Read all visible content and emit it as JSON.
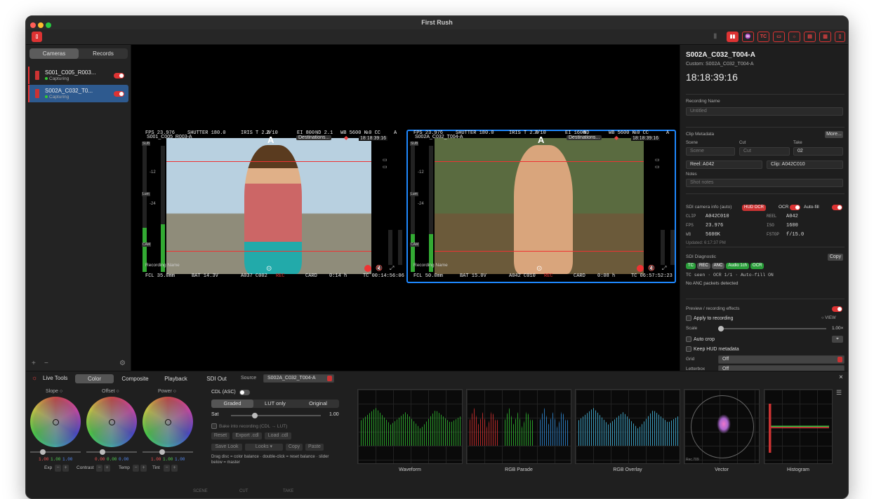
{
  "window": {
    "title": "First Rush"
  },
  "sidebar": {
    "tabs": [
      "Cameras",
      "Records"
    ],
    "cameras": [
      {
        "name": "S001_C005_R003...",
        "status": "Capturing"
      },
      {
        "name": "S002A_C032_T0...",
        "status": "Capturing"
      }
    ],
    "footer": {
      "add": "+",
      "remove": "−"
    }
  },
  "feeds": [
    {
      "name": "S001_C005_R003-A",
      "letter": "A",
      "destinations": "Destinations...",
      "tc": "18:18:39:16",
      "top": {
        "fps": "FPS 23.976",
        "shutter": "SHUTTER 180.0",
        "iris": "IRIS T 2.8",
        "iris_frac": "2/10",
        "ei": "EI 800",
        "nd": "ND 2.1",
        "wb": "WB 5600 K",
        "cc": "±0 CC",
        "a": "A"
      },
      "rec_label": "Recording Name",
      "bottom": {
        "fcl": "FCL 35.0mm",
        "bat": "BAT 14.3V",
        "clip": "A037 C002",
        "rec": "REC",
        "card": "CARD",
        "time": "0:14 h",
        "tcv": "TC 00:14:56:06"
      },
      "meter": {
        "marks": [
          "-12",
          "-24"
        ],
        "labels": [
          "SUB",
          "Lum",
          "CAM"
        ]
      },
      "levels": [
        0.35,
        0.38
      ],
      "colors": {
        "sky": "#b8d0e0",
        "ground": "#8f8c7a"
      }
    },
    {
      "name": "S002A_C032_T004-A",
      "letter": "A",
      "destinations": "Destinations...",
      "tc": "18:18:39:16",
      "top": {
        "fps": "FPS 23.976",
        "shutter": "SHUTTER 180.0",
        "iris": "IRIS T 2.8",
        "iris_frac": "7/10",
        "ei": "EI 1600",
        "nd": "ND",
        "wb": "WB 5600 K",
        "cc": "±0 CC",
        "a": "A"
      },
      "rec_label": "Recording Name",
      "bottom": {
        "fcl": "FCL 50.0mm",
        "bat": "BAT 15.0V",
        "clip": "A042 C010",
        "rec": "REC",
        "card": "CARD",
        "time": "0:08 h",
        "tcv": "TC 06:57:52:23"
      },
      "meter": {
        "marks": [
          "-12",
          "-24"
        ],
        "labels": [
          "SUB",
          "Lum",
          "CAM"
        ]
      },
      "levels": [
        0.3,
        0.3
      ],
      "colors": {
        "sky": "#5a6b40",
        "ground": "#6b5a3a"
      }
    }
  ],
  "inspector": {
    "clip_title": "S002A_C032_T004-A",
    "custom": "Custom: S002A_C032_T004-A",
    "timecode": "18:18:39:16",
    "recording_name_label": "Recording Name",
    "recording_name_placeholder": "Untitled",
    "clip_meta_label": "Clip Metadata",
    "more": "More...",
    "scene_label": "Scene",
    "scene_ph": "Scene",
    "cut_label": "Cut",
    "cut_ph": "Cut",
    "take_label": "Take",
    "take_val": "02",
    "reel": "Reel: A042",
    "clip": "Clip: A042C010",
    "notes_label": "Notes",
    "notes_ph": "Shot notes",
    "sdi_label": "SDI camera info (auto)",
    "hud_ocr": "HUD OCR",
    "ocr": "OCR",
    "autofill": "Auto-fill",
    "sdi_rows": [
      [
        "CLIP",
        "A042C010",
        "REEL",
        "A042"
      ],
      [
        "FPS",
        "23.976",
        "ISO",
        "1600"
      ],
      [
        "WB",
        "5600K",
        "FSTOP",
        "f/15.0"
      ]
    ],
    "updated": "Updated: 6:17:37 PM",
    "diag_label": "SDI Diagnostic",
    "copy": "Copy",
    "diag_pills": [
      "TC",
      "REC",
      "ANC",
      "Audio 1ch",
      "OCR"
    ],
    "diag_line": "TC seen · OCR 1/1 · Auto-fill ON",
    "diag_line2": "No ANC packets detected",
    "preview_label": "Preview / recording effects",
    "apply": "Apply to recording",
    "scale": "Scale",
    "view": "VIEW",
    "scale_val": "1.00×",
    "autocrop": "Auto crop",
    "keephud": "Keep HUD metadata",
    "grid": "Grid",
    "grid_val": "Off",
    "letterbox": "Letterbox",
    "letterbox_val": "Off"
  },
  "bottom": {
    "live_tools": "Live Tools",
    "tabs": [
      "Color",
      "Composite",
      "Playback",
      "SDI Out"
    ],
    "source_label": "Source",
    "source_val": "S002A_C032_T004-A",
    "wheels": [
      {
        "name": "Slope ○",
        "vals": [
          "1.00",
          "1.00",
          "1.00"
        ]
      },
      {
        "name": "Offset ○",
        "vals": [
          "0.00",
          "0.00",
          "0.00"
        ]
      },
      {
        "name": "Power ○",
        "vals": [
          "1.00",
          "1.00",
          "1.00"
        ]
      }
    ],
    "mini": [
      "Exp",
      "Contrast",
      "Temp",
      "Tint"
    ],
    "cdl_label": "CDL (ASC)",
    "modes": [
      "Graded",
      "LUT only",
      "Original"
    ],
    "sat_label": "Sat",
    "sat_val": "1.00",
    "bake": "Bake into recording (CDL → LUT)",
    "buttons1": [
      "Reset",
      "Export .cdl",
      "Load .cdl"
    ],
    "buttons2": [
      "Save Look",
      "Looks ▾",
      "Copy",
      "Paste"
    ],
    "hint": "Drag disc = color balance · double-click = reset balance · slider below = master",
    "scopes": [
      "Waveform",
      "RGB Parade",
      "RGB Overlay",
      "Vector",
      "Histogram"
    ],
    "rec709": "Rec.709",
    "footer": [
      "SCENE",
      "CUT",
      "TAKE"
    ]
  }
}
